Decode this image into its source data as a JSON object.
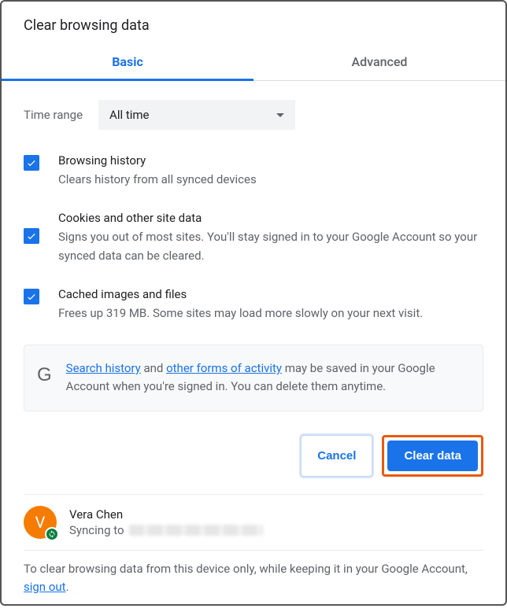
{
  "title": "Clear browsing data",
  "tabs": {
    "basic": "Basic",
    "advanced": "Advanced"
  },
  "timeRange": {
    "label": "Time range",
    "value": "All time"
  },
  "options": {
    "history": {
      "title": "Browsing history",
      "desc": "Clears history from all synced devices"
    },
    "cookies": {
      "title": "Cookies and other site data",
      "desc": "Signs you out of most sites. You'll stay signed in to your Google Account so your synced data can be cleared."
    },
    "cache": {
      "title": "Cached images and files",
      "desc": "Frees up 319 MB. Some sites may load more slowly on your next visit."
    }
  },
  "info": {
    "link1": "Search history",
    "mid1": " and ",
    "link2": "other forms of activity",
    "rest": " may be saved in your Google Account when you're signed in. You can delete them anytime."
  },
  "buttons": {
    "cancel": "Cancel",
    "clear": "Clear data"
  },
  "profile": {
    "name": "Vera Chen",
    "initial": "V",
    "syncing": "Syncing to "
  },
  "footer": {
    "pre": "To clear browsing data from this device only, while keeping it in your Google Account, ",
    "link": "sign out",
    "post": "."
  }
}
